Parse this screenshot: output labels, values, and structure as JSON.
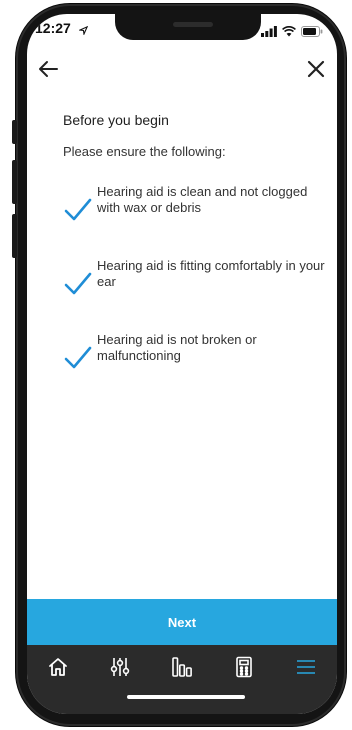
{
  "status_bar": {
    "time": "12:27"
  },
  "header": {
    "back_icon": "back-arrow-icon",
    "close_icon": "close-icon"
  },
  "main": {
    "title": "Before you begin",
    "subtitle": "Please ensure the following:",
    "checks": [
      {
        "text": "Hearing aid is clean and not clogged with wax or debris",
        "icon": "checkmark-icon"
      },
      {
        "text": "Hearing aid is fitting comfortably in your ear",
        "icon": "checkmark-icon"
      },
      {
        "text": "Hearing aid is not broken or malfunctioning",
        "icon": "checkmark-icon"
      }
    ]
  },
  "next_button": {
    "label": "Next"
  },
  "tabs": [
    {
      "icon": "home-icon"
    },
    {
      "icon": "sliders-icon"
    },
    {
      "icon": "equalizer-icon"
    },
    {
      "icon": "remote-control-icon"
    },
    {
      "icon": "menu-icon",
      "active": true
    }
  ],
  "colors": {
    "accent": "#27a7df",
    "tabbar": "#2b2b2b",
    "check": "#1f8dd6"
  }
}
